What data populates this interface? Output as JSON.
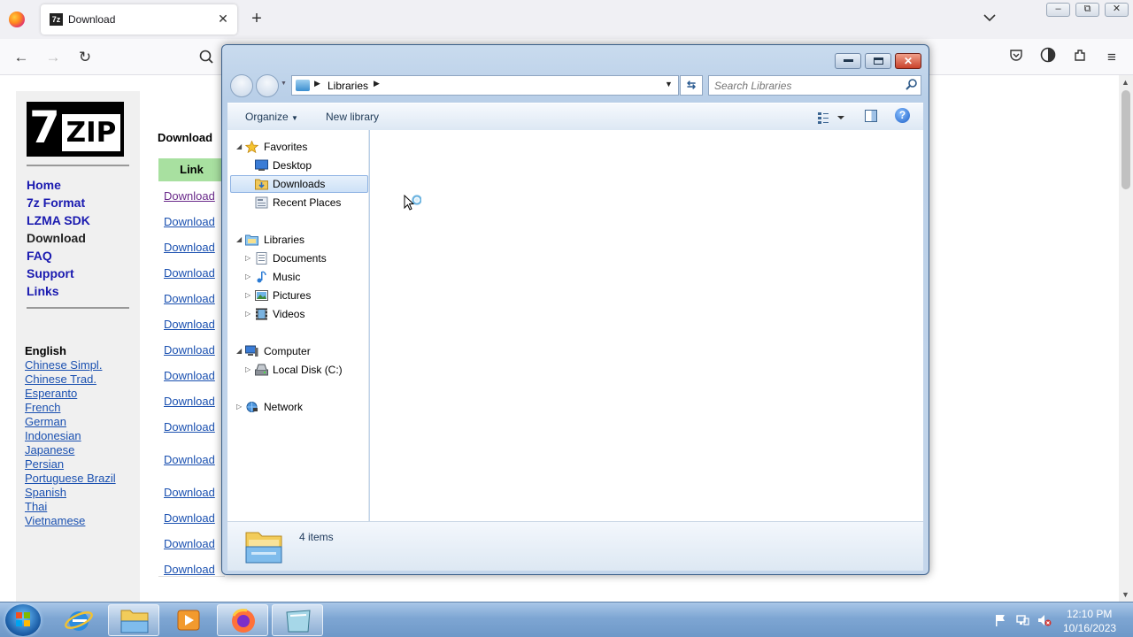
{
  "browser": {
    "tab_title": "Download",
    "tab_favicon_text": "7z",
    "tab_close": "✕",
    "new_tab": "+",
    "tab_list": "⌄",
    "win_min": "–",
    "win_restore": "⧉",
    "win_close": "✕",
    "back": "←",
    "forward": "→",
    "reload": "↻",
    "menu": "≡"
  },
  "website": {
    "logo_seven": "7",
    "logo_zip": "ZIP",
    "nav": [
      "Home",
      "7z Format",
      "LZMA SDK",
      "Download",
      "FAQ",
      "Support",
      "Links"
    ],
    "current_nav": "Download",
    "language_current": "English",
    "languages": [
      "Chinese Simpl.",
      "Chinese Trad.",
      "Esperanto",
      "French",
      "German",
      "Indonesian",
      "Japanese",
      "Persian",
      "Portuguese Brazil",
      "Spanish",
      "Thai",
      "Vietnamese"
    ],
    "heading": "Download",
    "table_header": "Link",
    "download_label": "Download"
  },
  "explorer": {
    "address_text": "Libraries",
    "search_placeholder": "Search Libraries",
    "toolbar": {
      "organize": "Organize",
      "new_library": "New library",
      "help": "?"
    },
    "tree": {
      "favorites": "Favorites",
      "desktop": "Desktop",
      "downloads": "Downloads",
      "recent_places": "Recent Places",
      "libraries": "Libraries",
      "documents": "Documents",
      "music": "Music",
      "pictures": "Pictures",
      "videos": "Videos",
      "computer": "Computer",
      "local_disk": "Local Disk (C:)",
      "network": "Network"
    },
    "items_count": "4 items",
    "close_glyph": "✕"
  },
  "taskbar": {
    "time": "12:10 PM",
    "date": "10/16/2023"
  },
  "colors": {
    "link_blue": "#1a50b0",
    "nav_blue": "#1a1ab0",
    "table_header_green": "#a8e0a0",
    "selection_blue": "#cde1f7"
  }
}
